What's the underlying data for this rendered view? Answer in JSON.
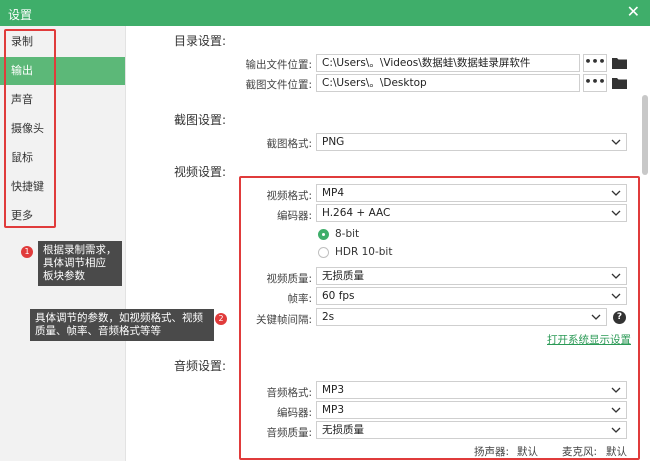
{
  "window": {
    "title": "设置",
    "close_glyph": "✕"
  },
  "sidebar": {
    "items": [
      {
        "label": "录制",
        "active": false
      },
      {
        "label": "输出",
        "active": true
      },
      {
        "label": "声音",
        "active": false
      },
      {
        "label": "摄像头",
        "active": false
      },
      {
        "label": "鼠标",
        "active": false
      },
      {
        "label": "快捷键",
        "active": false
      },
      {
        "label": "更多",
        "active": false
      }
    ]
  },
  "annotations": {
    "badge1": "1",
    "tip1": [
      "根据录制需求，",
      "具体调节相应",
      "板块参数"
    ],
    "badge2": "2",
    "tip2": [
      "具体调节的参数，如视频格式、视频",
      "质量、帧率、音频格式等等"
    ]
  },
  "directory": {
    "title": "目录设置:",
    "output_label": "输出文件位置:",
    "output_value": "C:\\Users\\。\\Videos\\数据蛙\\数据蛙录屏软件",
    "capture_label": "截图文件位置:",
    "capture_value": "C:\\Users\\。\\Desktop",
    "dots": "•••"
  },
  "screenshot": {
    "title": "截图设置:",
    "format_label": "截图格式:",
    "format_value": "PNG"
  },
  "video": {
    "title": "视频设置:",
    "format_label": "视频格式:",
    "format_value": "MP4",
    "encoder_label": "编码器:",
    "encoder_value": "H.264 + AAC",
    "bit8_label": "8-bit",
    "hdr_label": "HDR 10-bit",
    "quality_label": "视频质量:",
    "quality_value": "无损质量",
    "fps_label": "帧率:",
    "fps_value": "60 fps",
    "keyframe_label": "关键帧间隔:",
    "keyframe_value": "2s",
    "help_glyph": "?",
    "system_display_link": "打开系统显示设置"
  },
  "audio": {
    "title": "音频设置:",
    "format_label": "音频格式:",
    "format_value": "MP3",
    "encoder_label": "编码器:",
    "encoder_value": "MP3",
    "quality_label": "音频质量:",
    "quality_value": "无损质量",
    "speaker_label": "扬声器:",
    "speaker_value": "默认",
    "mic_label": "麦克风:",
    "mic_value": "默认"
  },
  "colors": {
    "accent": "#3fae6a",
    "active_nav": "#5cb878",
    "highlight": "#e03b3b",
    "link": "#2b9a56"
  }
}
